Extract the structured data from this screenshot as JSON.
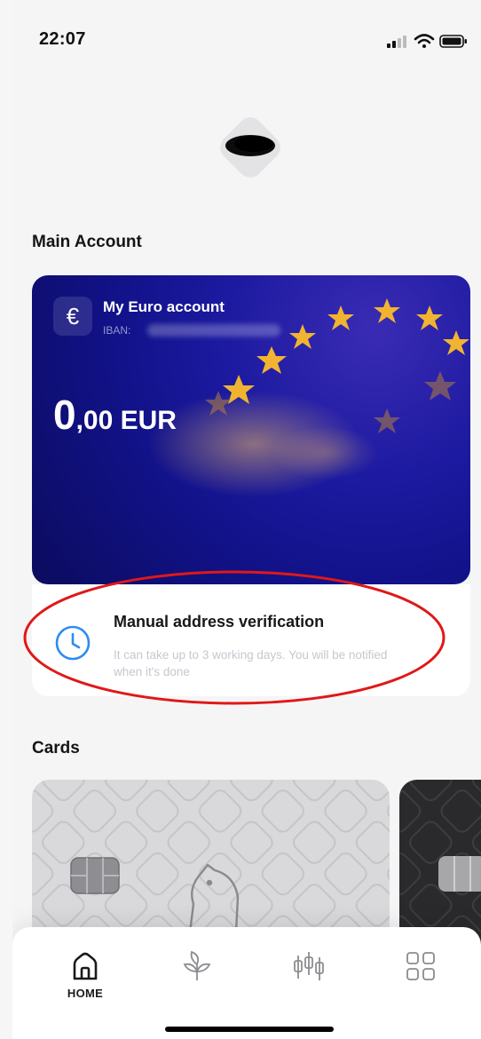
{
  "status_bar": {
    "time": "22:07"
  },
  "sections": {
    "main_account": "Main Account",
    "cards": "Cards"
  },
  "account": {
    "currency_symbol": "€",
    "name": "My Euro account",
    "iban_label": "IBAN:",
    "balance_major": "0",
    "balance_minor": ",00 EUR"
  },
  "verification": {
    "title": "Manual address verification",
    "subtitle": "It can take up to 3 working days. You will be notified when it's done"
  },
  "nav": {
    "home_label": "HOME"
  },
  "colors": {
    "accent_blue": "#2d8cf0",
    "card_blue": "#1c1aa0",
    "highlight_red": "#e01818"
  },
  "icons": [
    "signal-icon",
    "wifi-icon",
    "battery-icon",
    "euro-icon",
    "clock-icon",
    "home-icon",
    "sprout-icon",
    "candlestick-icon",
    "grid-icon"
  ]
}
